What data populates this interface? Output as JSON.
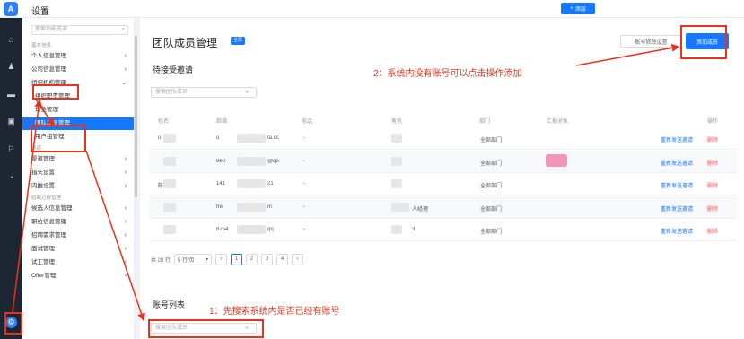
{
  "app": {
    "logo_text": "A",
    "title": "设置"
  },
  "topbar": {
    "add_label": "添加",
    "add_icon": "+",
    "icons": [
      {
        "name": "clock-icon",
        "glyph": "◷",
        "color": "#1f2633"
      },
      {
        "name": "help-icon",
        "glyph": "?",
        "color": "#2d7ff9"
      },
      {
        "name": "bell-icon",
        "glyph": "♪",
        "color": "#8c96a3"
      },
      {
        "name": "apps-icon",
        "glyph": "▦",
        "color": "#2d7ff9"
      },
      {
        "name": "avatar",
        "glyph": "◉",
        "color": "#ec5b8c"
      }
    ]
  },
  "rail": {
    "icons": [
      "home-icon",
      "people-icon",
      "briefcase-icon",
      "bag-icon",
      "chart-icon",
      "clock-icon",
      "settings-icon"
    ],
    "glyphs": [
      "⌂",
      "♟",
      "▬",
      "▣",
      "⚐",
      "◔",
      "⚙"
    ]
  },
  "sidebar": {
    "search_placeholder": "搜索功能选项",
    "search_icon": "⌕",
    "groups": [
      {
        "label": "基本信息",
        "type": "group"
      },
      {
        "label": "个人信息管理",
        "type": "item",
        "chev": "›"
      },
      {
        "label": "公司信息管理",
        "type": "item",
        "chev": "›"
      },
      {
        "label": "组织机构管理",
        "type": "item",
        "chev": "⌄",
        "highlight": true
      },
      {
        "label": "组织职责管理",
        "type": "sub"
      },
      {
        "label": "角色管理",
        "type": "sub"
      },
      {
        "label": "团队成员管理",
        "type": "sub",
        "active": true
      },
      {
        "label": "用户组管理",
        "type": "sub"
      },
      {
        "label": "渠道",
        "type": "group"
      },
      {
        "label": "渠道管理",
        "type": "item",
        "chev": "›"
      },
      {
        "label": "猎头设置",
        "type": "item",
        "chev": "›"
      },
      {
        "label": "内推设置",
        "type": "item",
        "chev": "›"
      },
      {
        "label": "招聘过程管理",
        "type": "group"
      },
      {
        "label": "候选人信息管理",
        "type": "item",
        "chev": "›"
      },
      {
        "label": "职位信息管理",
        "type": "item",
        "chev": "›"
      },
      {
        "label": "招聘需求管理",
        "type": "item",
        "chev": "›"
      },
      {
        "label": "面试管理",
        "type": "item",
        "chev": "›"
      },
      {
        "label": "试工管理",
        "type": "item",
        "chev": "›"
      },
      {
        "label": "Offer管理",
        "type": "item",
        "chev": "›"
      }
    ]
  },
  "main": {
    "title": "团队成员管理",
    "badge": "全局",
    "btn_account_settings": "账号修改设置",
    "btn_add_member": "添加成员",
    "pending_title": "待接受邀请",
    "pending_search_placeholder": "搜索团队成员",
    "search_icon": "⌕",
    "columns": [
      "姓名",
      "邮箱",
      "电话",
      "角色",
      "部门",
      "汇报对象",
      "操作"
    ],
    "rows": [
      {
        "name": "o",
        "email": "o",
        "email_tail": "ta.cc",
        "phone": "-",
        "role": "",
        "dept": "全部部门",
        "report": "",
        "resend": "重新发送邀请",
        "delete": "删除"
      },
      {
        "name": "",
        "email": "960",
        "email_tail": "@qo",
        "phone": "-",
        "role": "",
        "dept": "全部部门",
        "report": "pink",
        "resend": "重新发送邀请",
        "delete": "删除"
      },
      {
        "name": "陈",
        "email": "141",
        "email_tail": "21",
        "phone": "-",
        "role": "",
        "dept": "全部部门",
        "report": "",
        "resend": "重新发送邀请",
        "delete": "删除"
      },
      {
        "name": "",
        "email": "fre",
        "email_tail": "m",
        "phone": "-",
        "role": "人经理",
        "dept": "全部部门",
        "report": "",
        "resend": "重新发送邀请",
        "delete": "删除"
      },
      {
        "name": "",
        "email": "8754",
        "email_tail": "qq",
        "phone": "-",
        "role": "3",
        "dept": "全部部门",
        "report": "",
        "resend": "重新发送邀请",
        "delete": "删除"
      }
    ],
    "pager": {
      "total": "共 20 行",
      "size": "5 行/页",
      "size_chev": "▾",
      "prev": "‹",
      "next": "›",
      "pages": [
        "1",
        "2",
        "3",
        "4"
      ]
    },
    "account_title": "账号列表",
    "account_search_placeholder": "搜索团队成员"
  },
  "annotations": {
    "step1": "1：先搜索系统内是否已经有账号",
    "step2": "2：系统内没有账号可以点击操作添加",
    "color": "#e8321c"
  },
  "floating": [
    {
      "name": "chat-icon",
      "glyph": "◎",
      "color": "#1f2633"
    },
    {
      "name": "support-icon",
      "glyph": "☺",
      "color": "#2d7ff9"
    }
  ]
}
